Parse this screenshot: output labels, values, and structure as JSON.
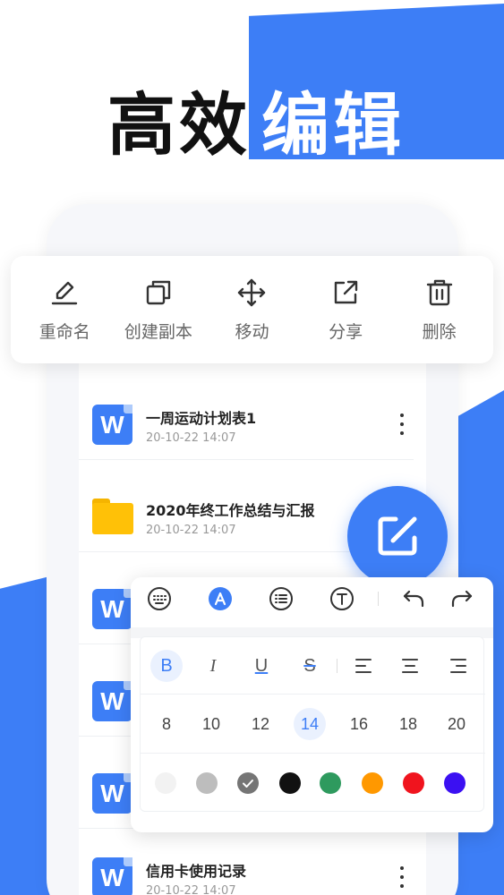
{
  "headline": {
    "dark": "高效",
    "light": "编辑"
  },
  "actions": [
    {
      "label": "重命名",
      "icon": "pencil-icon"
    },
    {
      "label": "创建副本",
      "icon": "copy-icon"
    },
    {
      "label": "移动",
      "icon": "move-icon"
    },
    {
      "label": "分享",
      "icon": "share-icon"
    },
    {
      "label": "删除",
      "icon": "trash-icon"
    }
  ],
  "files": [
    {
      "name": "一周运动计划表1",
      "date": "20-10-22 14:07",
      "type": "word"
    },
    {
      "name": "2020年终工作总结与汇报",
      "date": "20-10-22 14:07",
      "type": "folder"
    },
    {
      "name": "",
      "date": "",
      "type": "word"
    },
    {
      "name": "",
      "date": "",
      "type": "word"
    },
    {
      "name": "",
      "date": "",
      "type": "word"
    },
    {
      "name": "信用卡使用记录",
      "date": "20-10-22 14:07",
      "type": "word"
    }
  ],
  "editor": {
    "top_tools": [
      "keyboard-icon",
      "font-color-icon",
      "list-icon",
      "text-style-icon",
      "undo-icon",
      "redo-icon"
    ],
    "format_buttons": [
      {
        "label": "B",
        "name": "bold-button",
        "active": true
      },
      {
        "label": "I",
        "name": "italic-button",
        "active": false
      },
      {
        "label": "U",
        "name": "underline-button",
        "active": false
      },
      {
        "label": "S",
        "name": "strikethrough-button",
        "active": false
      }
    ],
    "align_buttons": [
      "align-left-icon",
      "align-center-icon",
      "align-right-icon"
    ],
    "font_sizes": [
      "8",
      "10",
      "12",
      "14",
      "16",
      "18",
      "20"
    ],
    "selected_size": "14",
    "colors": [
      "#f2f2f2",
      "#bdbdbd",
      "#757575",
      "#111111",
      "#2e9a5e",
      "#ff9800",
      "#f0141e",
      "#3b10f2"
    ],
    "selected_color": "#757575"
  },
  "accent_color": "#3d7ef6"
}
